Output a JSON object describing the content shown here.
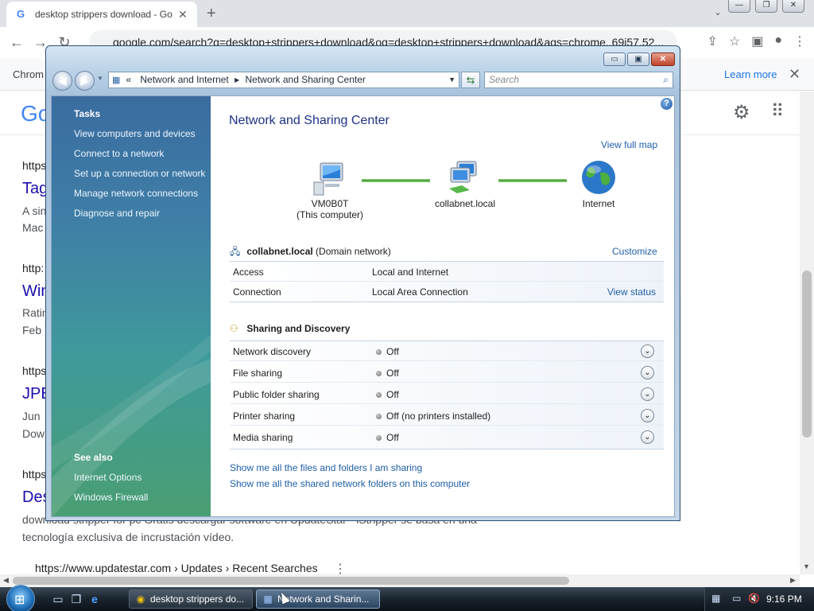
{
  "browser": {
    "tab_title": "desktop strippers download - Go",
    "tab_close": "✕",
    "new_tab": "+",
    "tab_search": "⌄",
    "win_min": "—",
    "win_max": "❐",
    "win_close": "✕",
    "url": "google.com/search?q=desktop+strippers+download&oq=desktop+strippers+download&aqs=chrome..69i57.52...",
    "info_text": "Chrom",
    "learn_more": "Learn more",
    "info_close": "✕",
    "google_logo": "Go",
    "results": [
      {
        "text": "https",
        "kind": "url"
      },
      {
        "text": "Tag",
        "kind": "title"
      },
      {
        "text": "A sin",
        "kind": "snippet"
      },
      {
        "text": "Mac",
        "kind": "snippet"
      },
      {
        "text": "http:",
        "kind": "url"
      },
      {
        "text": "Win",
        "kind": "title"
      },
      {
        "text": "Ratin",
        "kind": "snippet"
      },
      {
        "text": "Feb",
        "kind": "snippet"
      },
      {
        "text": "https",
        "kind": "url"
      },
      {
        "text": "JPE",
        "kind": "title"
      },
      {
        "text": "Jun",
        "kind": "snippet"
      },
      {
        "text": "Dow",
        "kind": "snippet"
      },
      {
        "text": "https",
        "kind": "url"
      },
      {
        "text": "Des",
        "kind": "title"
      },
      {
        "text": "download stripper for pc Gratis descargar software en UpdateStar - iStripper se basa en una",
        "kind": "snippet"
      },
      {
        "text": "tecnología exclusiva de incrustación vídeo.",
        "kind": "snippet"
      },
      {
        "text": "https://www.updatestar.com › Updates › Recent Searches",
        "kind": "url"
      }
    ]
  },
  "window": {
    "title_min": "▭",
    "title_max": "▣",
    "title_close": "✕",
    "address": {
      "prefix": "«",
      "crumb1": "Network and Internet",
      "sep": "▸",
      "crumb2": "Network and Sharing Center"
    },
    "search_placeholder": "Search",
    "tasks": {
      "heading": "Tasks",
      "items": [
        "View computers and devices",
        "Connect to a network",
        "Set up a connection or network",
        "Manage network connections",
        "Diagnose and repair"
      ]
    },
    "see_also": {
      "heading": "See also",
      "items": [
        "Internet Options",
        "Windows Firewall"
      ]
    },
    "help": "?",
    "title": "Network and Sharing Center",
    "view_full_map": "View full map",
    "map": {
      "computer_name": "VM0B0T",
      "computer_sub": "(This computer)",
      "network_name": "collabnet.local",
      "internet": "Internet"
    },
    "network": {
      "name": "collabnet.local",
      "type": "(Domain network)",
      "customize": "Customize",
      "access_label": "Access",
      "access_value": "Local and Internet",
      "connection_label": "Connection",
      "connection_value": "Local Area Connection",
      "view_status": "View status"
    },
    "sharing": {
      "heading": "Sharing and Discovery",
      "rows": [
        {
          "label": "Network discovery",
          "value": "Off"
        },
        {
          "label": "File sharing",
          "value": "Off"
        },
        {
          "label": "Public folder sharing",
          "value": "Off"
        },
        {
          "label": "Printer sharing",
          "value": "Off (no printers installed)"
        },
        {
          "label": "Media sharing",
          "value": "Off"
        }
      ]
    },
    "bottom_links": [
      "Show me all the files and folders I am sharing",
      "Show me all the shared network folders on this computer"
    ]
  },
  "taskbar": {
    "tasks": [
      {
        "label": "desktop strippers do...",
        "icon": "chrome-icon"
      },
      {
        "label": "Network and Sharin...",
        "icon": "network-icon"
      }
    ],
    "clock": "9:16 PM"
  }
}
